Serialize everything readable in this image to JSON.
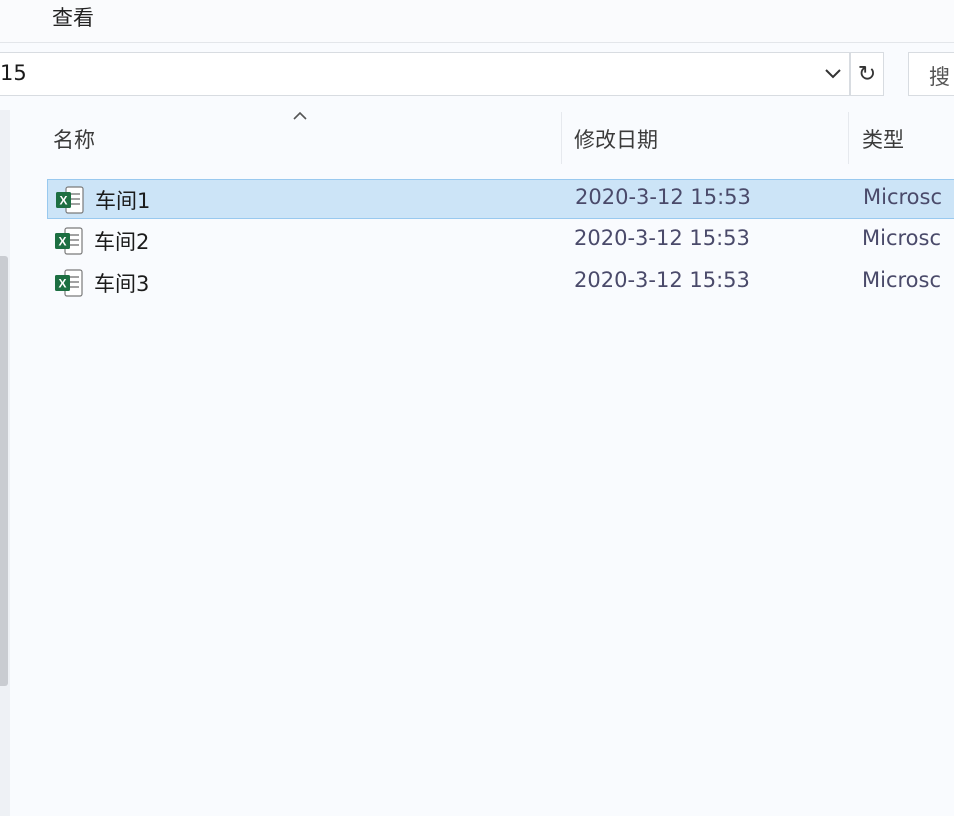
{
  "ribbon": {
    "view_tab": "查看"
  },
  "address": {
    "path": "15",
    "search_placeholder": "搜"
  },
  "columns": {
    "name": "名称",
    "modified": "修改日期",
    "type": "类型"
  },
  "files": [
    {
      "name": "车间1",
      "modified": "2020-3-12 15:53",
      "type": "Microsc",
      "selected": true,
      "icon": "excel-file-icon"
    },
    {
      "name": "车间2",
      "modified": "2020-3-12 15:53",
      "type": "Microsc",
      "selected": false,
      "icon": "excel-file-icon"
    },
    {
      "name": "车间3",
      "modified": "2020-3-12 15:53",
      "type": "Microsc",
      "selected": false,
      "icon": "excel-file-icon"
    }
  ],
  "colors": {
    "selection": "#cce4f7",
    "selection_border": "#99c9ef",
    "excel_green": "#1d6f42"
  }
}
